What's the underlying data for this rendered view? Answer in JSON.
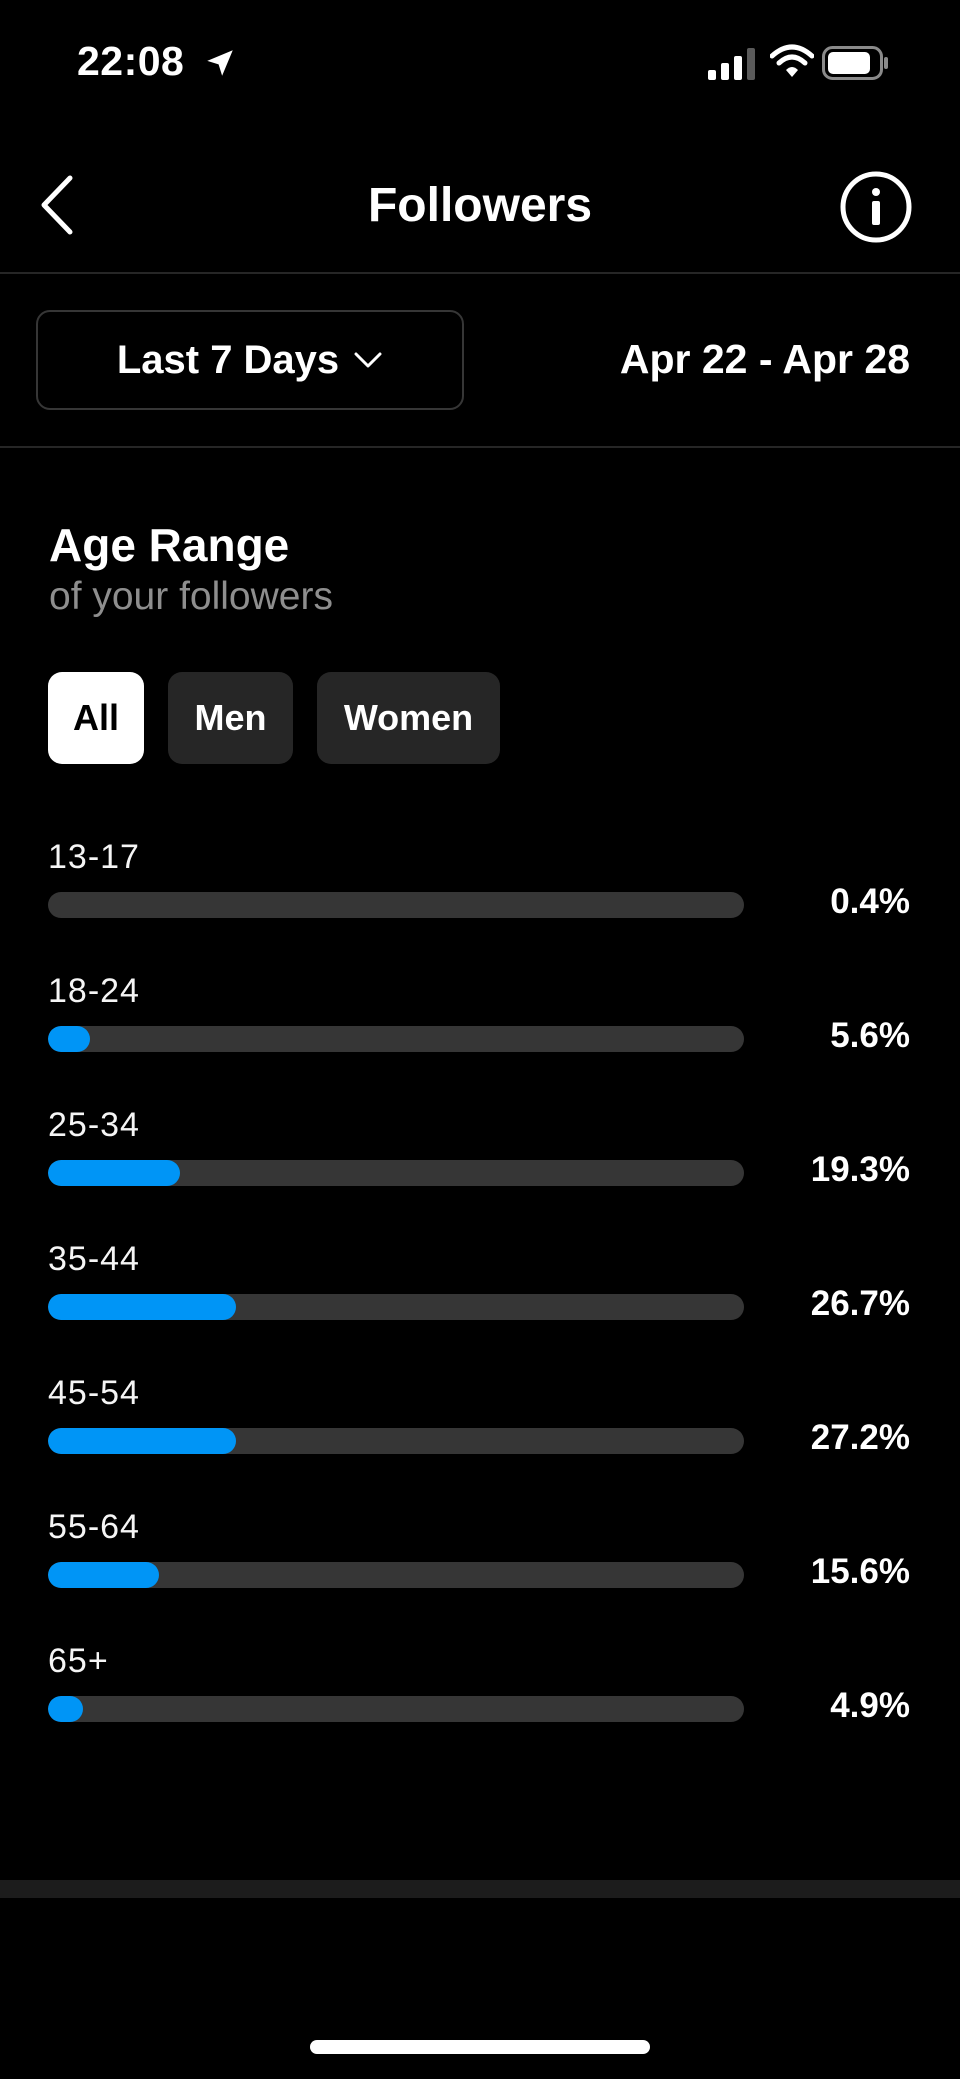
{
  "status_bar": {
    "time": "22:08",
    "icons": [
      "location-arrow-icon",
      "signal-icon",
      "wifi-icon",
      "battery-icon"
    ]
  },
  "header": {
    "title": "Followers",
    "back_icon": "chevron-left-icon",
    "info_icon": "info-icon"
  },
  "filters": {
    "range_label": "Last 7 Days",
    "range_icon": "chevron-down-icon",
    "date_range": "Apr 22 - Apr 28"
  },
  "section": {
    "title": "Age Range",
    "subtitle": "of your followers",
    "tabs": [
      "All",
      "Men",
      "Women"
    ],
    "selected_tab": "All"
  },
  "chart_data": {
    "type": "bar",
    "categories": [
      "13-17",
      "18-24",
      "25-34",
      "35-44",
      "45-54",
      "55-64",
      "65+"
    ],
    "values": [
      0.4,
      5.6,
      19.3,
      26.7,
      27.2,
      15.6,
      4.9
    ],
    "labels": [
      "0.4%",
      "5.6%",
      "19.3%",
      "26.7%",
      "27.2%",
      "15.6%",
      "4.9%"
    ],
    "fill_fraction": [
      0.0,
      0.06,
      0.19,
      0.27,
      0.27,
      0.16,
      0.05
    ],
    "bar_color": "#0095f6",
    "track_color": "#363636"
  },
  "colors": {
    "background": "#000000",
    "accent": "#0095f6",
    "muted_text": "#8e8e8e",
    "chip_background": "#262626"
  }
}
